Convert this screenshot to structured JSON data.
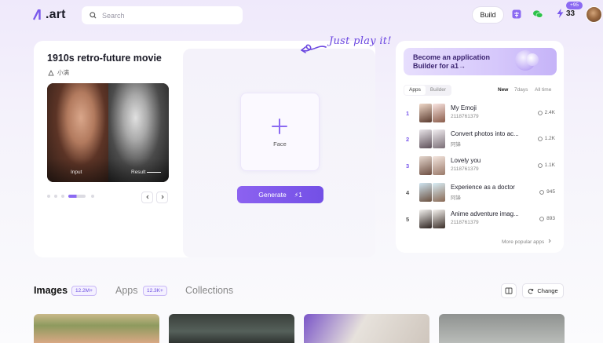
{
  "header": {
    "logo_text": ".art",
    "search_placeholder": "Search",
    "build_label": "Build",
    "energy_count": "33",
    "energy_badge": "+95"
  },
  "hero": {
    "title": "1910s retro-future movie",
    "author": "小满",
    "input_label": "Input",
    "result_label": "Result",
    "face_label": "Face",
    "generate_label": "Generate",
    "generate_cost": "1",
    "tagline": "Just play it!"
  },
  "apps_panel": {
    "banner": "Become an application Builder for a1→",
    "tabs": [
      "Apps",
      "Builder"
    ],
    "active_tab": "Apps",
    "filters": [
      "New",
      "7days",
      "All time"
    ],
    "active_filter": "New",
    "items": [
      {
        "rank": "1",
        "name": "My Emoji",
        "author": "2118761379",
        "count": "2.4K"
      },
      {
        "rank": "2",
        "name": "Convert photos into ac...",
        "author": "阿锋",
        "count": "1.2K"
      },
      {
        "rank": "3",
        "name": "Lovely you",
        "author": "2118761379",
        "count": "1.1K"
      },
      {
        "rank": "4",
        "name": "Experience as a doctor",
        "author": "阿锋",
        "count": "945"
      },
      {
        "rank": "5",
        "name": "Anime adventure imag...",
        "author": "2118761379",
        "count": "893"
      }
    ],
    "more_label": "More popular apps"
  },
  "content_tabs": {
    "images_label": "Images",
    "images_count": "12.2M+",
    "apps_label": "Apps",
    "apps_count": "12.3K+",
    "collections_label": "Collections",
    "change_label": "Change"
  },
  "colors": {
    "accent": "#7a59ec",
    "background_top": "#efe9fb"
  }
}
